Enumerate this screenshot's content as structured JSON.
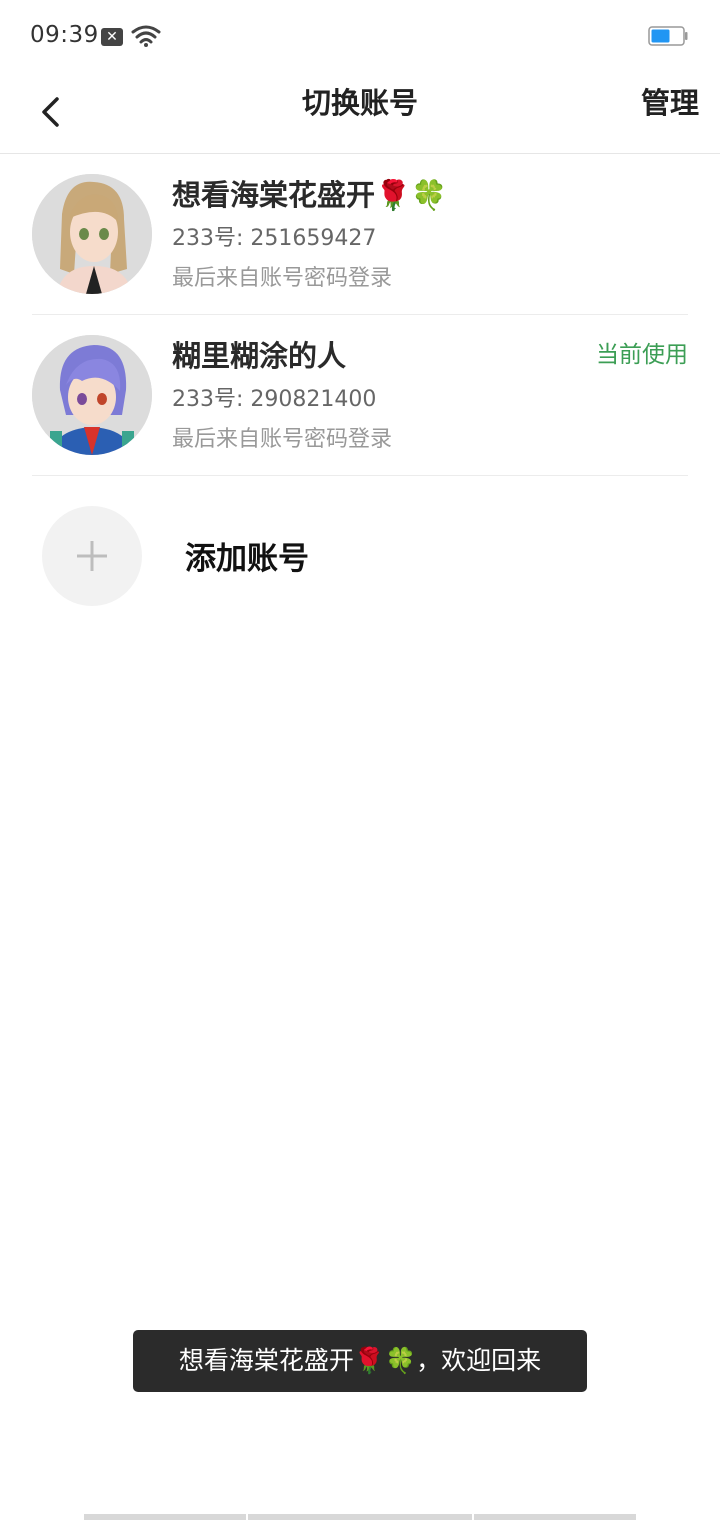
{
  "status_bar": {
    "time": "09:39",
    "notification_icon": "close-box-icon",
    "wifi_icon": "wifi-icon",
    "battery_icon": "battery-icon",
    "battery_color": "#2196f3"
  },
  "nav": {
    "title": "切换账号",
    "manage_label": "管理",
    "back_icon": "chevron-left-icon"
  },
  "accounts": [
    {
      "name": "想看海棠花盛开🌹🍀",
      "id_text": "233号: 251659427",
      "login_text": "最后来自账号密码登录",
      "current": false
    },
    {
      "name": "糊里糊涂的人",
      "id_text": "233号: 290821400",
      "login_text": "最后来自账号密码登录",
      "current": true,
      "current_label": "当前使用"
    }
  ],
  "add_account": {
    "label": "添加账号",
    "icon": "plus-icon"
  },
  "toast": {
    "message": "想看海棠花盛开🌹🍀，欢迎回来"
  },
  "colors": {
    "accent_green": "#3c9e55",
    "toast_bg": "#2b2b2b"
  }
}
